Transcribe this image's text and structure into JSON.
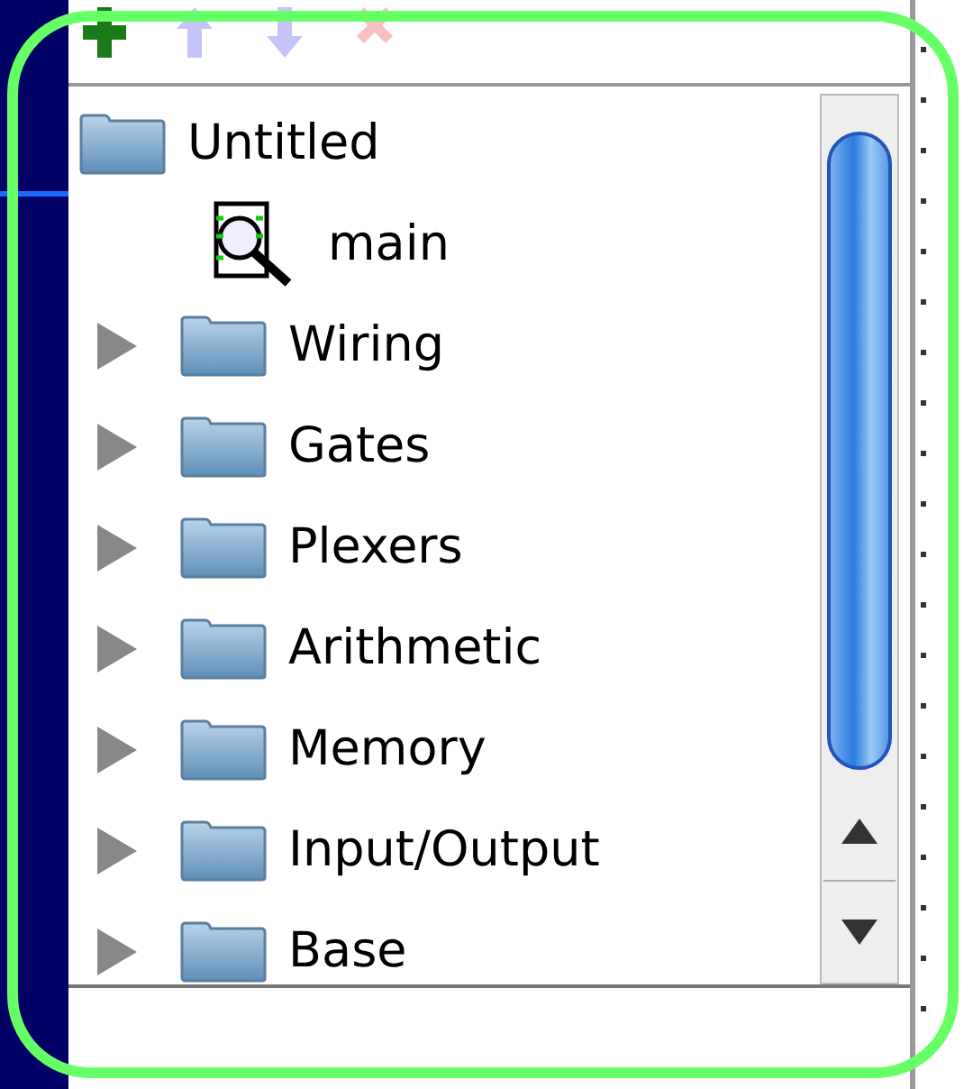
{
  "toolbar": [
    {
      "kind": "add",
      "disabled": false
    },
    {
      "kind": "up",
      "disabled": true
    },
    {
      "kind": "down",
      "disabled": true
    },
    {
      "kind": "delete",
      "disabled": true
    }
  ],
  "tree": {
    "label": "Untitled",
    "children": [
      {
        "label": "main",
        "kind": "circuit"
      },
      {
        "label": "Wiring",
        "kind": "library",
        "expanded": false
      },
      {
        "label": "Gates",
        "kind": "library",
        "expanded": false
      },
      {
        "label": "Plexers",
        "kind": "library",
        "expanded": false
      },
      {
        "label": "Arithmetic",
        "kind": "library",
        "expanded": false
      },
      {
        "label": "Memory",
        "kind": "library",
        "expanded": false
      },
      {
        "label": "Input/Output",
        "kind": "library",
        "expanded": false
      },
      {
        "label": "Base",
        "kind": "library",
        "expanded": false
      }
    ]
  }
}
